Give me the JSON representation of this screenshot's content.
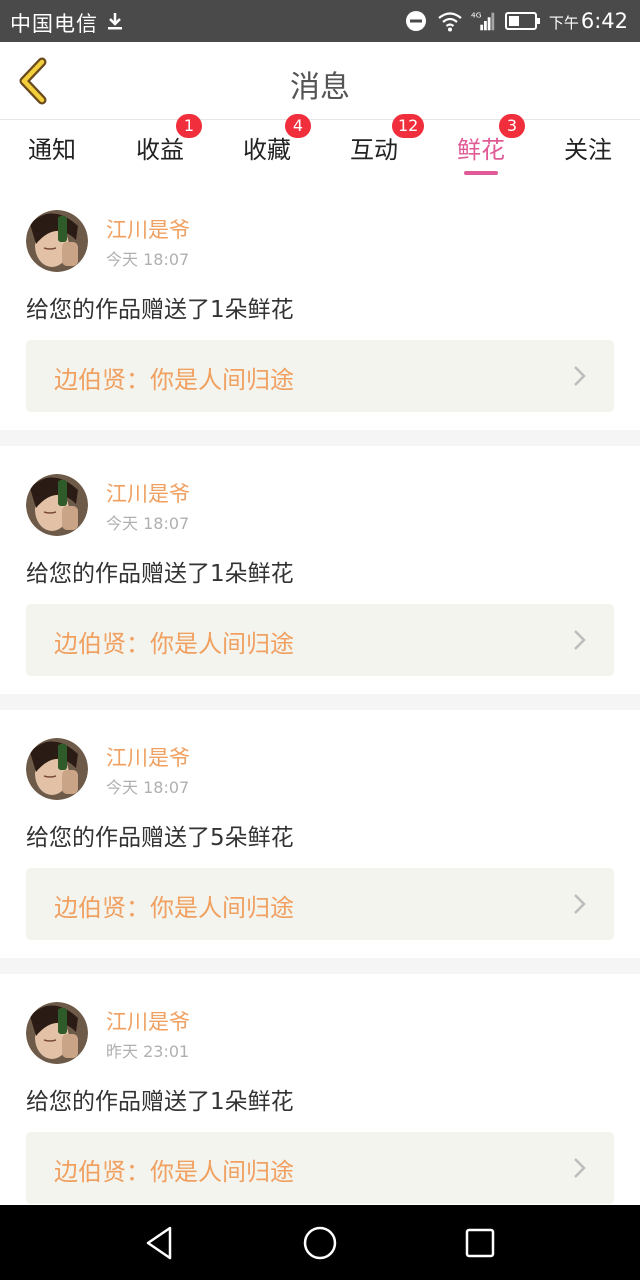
{
  "status_bar": {
    "carrier": "中国电信",
    "time_prefix": "下午",
    "time": "6:42",
    "network_label": "4G"
  },
  "header": {
    "title": "消息",
    "back_icon": "chevron-left-icon"
  },
  "tabs": [
    {
      "label": "通知",
      "badge": ""
    },
    {
      "label": "收益",
      "badge": "1"
    },
    {
      "label": "收藏",
      "badge": "4"
    },
    {
      "label": "互动",
      "badge": "12"
    },
    {
      "label": "鲜花",
      "badge": "3"
    },
    {
      "label": "关注",
      "badge": ""
    }
  ],
  "active_tab": "鲜花",
  "colors": {
    "accent": "#e05a96",
    "name": "#f0a061",
    "badge": "#f02e3c"
  },
  "messages": [
    {
      "user": "江川是爷",
      "time": "今天 18:07",
      "text": "给您的作品赠送了1朵鲜花",
      "work": "边伯贤：你是人间归途"
    },
    {
      "user": "江川是爷",
      "time": "今天 18:07",
      "text": "给您的作品赠送了1朵鲜花",
      "work": "边伯贤：你是人间归途"
    },
    {
      "user": "江川是爷",
      "time": "今天 18:07",
      "text": "给您的作品赠送了5朵鲜花",
      "work": "边伯贤：你是人间归途"
    },
    {
      "user": "江川是爷",
      "time": "昨天 23:01",
      "text": "给您的作品赠送了1朵鲜花",
      "work": "边伯贤：你是人间归途"
    }
  ]
}
